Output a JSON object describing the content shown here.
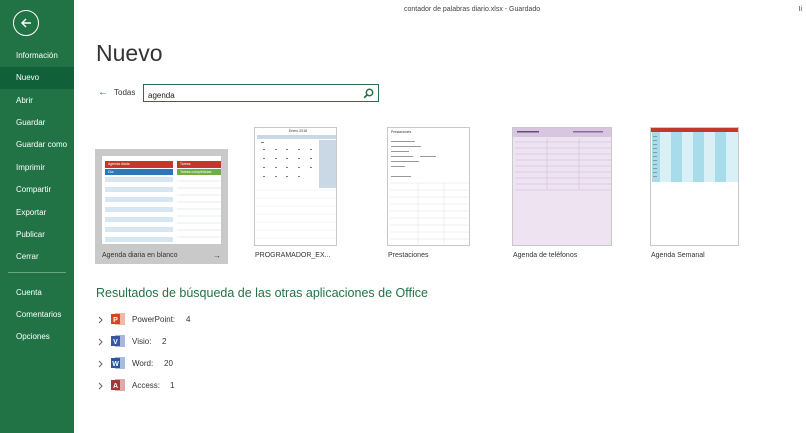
{
  "window": {
    "title": "contador de palabras diario.xlsx  -  Guardado",
    "corner_text": "Ii"
  },
  "sidebar": {
    "back_icon": "back-arrow-icon",
    "items": [
      {
        "label": "Información"
      },
      {
        "label": "Nuevo",
        "active": true
      },
      {
        "label": "Abrir"
      },
      {
        "label": "Guardar"
      },
      {
        "label": "Guardar como"
      },
      {
        "label": "Imprimir"
      },
      {
        "label": "Compartir"
      },
      {
        "label": "Exportar"
      },
      {
        "label": "Publicar"
      },
      {
        "label": "Cerrar"
      },
      {
        "label": "Cuenta"
      },
      {
        "label": "Comentarios"
      },
      {
        "label": "Opciones"
      }
    ]
  },
  "main": {
    "title": "Nuevo",
    "back_all_label": "Todas",
    "search": {
      "value": "agenda",
      "placeholder": ""
    },
    "templates": [
      {
        "name": "Agenda diaria en blanco",
        "selected": true,
        "thumb_header_left": "Agenda diaria",
        "thumb_header_right": "Tareas",
        "thumb_sub": "Día",
        "thumb_sub2": "Tareas completadas"
      },
      {
        "name": "PROGRAMADOR_EX...",
        "thumb_title": "Enero 2018"
      },
      {
        "name": "Prestaciones",
        "thumb_title": "Prestaciones"
      },
      {
        "name": "Agenda de teléfonos"
      },
      {
        "name": "Agenda Semanal"
      }
    ],
    "results_heading": "Resultados de búsqueda de las otras aplicaciones de Office",
    "apps": [
      {
        "label": "PowerPoint:",
        "count": "4",
        "icon": "powerpoint-icon",
        "color": "#d24726",
        "letter": "P"
      },
      {
        "label": "Visio:",
        "count": "2",
        "icon": "visio-icon",
        "color": "#3955a3",
        "letter": "V"
      },
      {
        "label": "Word:",
        "count": "20",
        "icon": "word-icon",
        "color": "#2b579a",
        "letter": "W"
      },
      {
        "label": "Access:",
        "count": "1",
        "icon": "access-icon",
        "color": "#a4373a",
        "letter": "A"
      }
    ]
  },
  "colors": {
    "accent": "#217346",
    "accent_dark": "#10603a"
  }
}
